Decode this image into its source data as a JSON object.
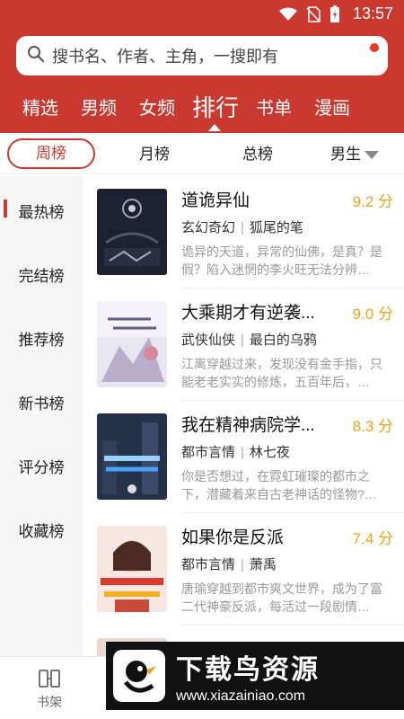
{
  "status": {
    "time": "13:57"
  },
  "search": {
    "placeholder": "搜书名、作者、主角，一搜即有"
  },
  "nav": {
    "items": [
      "精选",
      "男频",
      "女频",
      "排行",
      "书单",
      "漫画"
    ],
    "active": "排行"
  },
  "subtabs": {
    "items": [
      "周榜",
      "月榜",
      "总榜"
    ],
    "gender": "男生"
  },
  "sidebar": {
    "items": [
      "最热榜",
      "完结榜",
      "推荐榜",
      "新书榜",
      "评分榜",
      "收藏榜"
    ]
  },
  "books": [
    {
      "title": "道诡异仙",
      "score": "9.2 分",
      "genre": "玄幻奇幻",
      "author": "狐尾的笔",
      "desc": "诡异的天道，异常的仙佛，是真？是假？陷入迷惘的李火旺无法分辨…"
    },
    {
      "title": "大乘期才有逆袭...",
      "score": "9.0 分",
      "genre": "武侠仙侠",
      "author": "最白的乌鸦",
      "desc": "江离穿越过来，发现没有金手指，只能老老实实的修炼，五百年后，…"
    },
    {
      "title": "我在精神病院学...",
      "score": "8.3 分",
      "genre": "都市言情",
      "author": "林七夜",
      "desc": "你是否想过，在霓虹璀璨的都市之下，潜藏着来自古老神话的怪物?…"
    },
    {
      "title": "如果你是反派",
      "score": "7.4 分",
      "genre": "都市言情",
      "author": "萧禹",
      "desc": "唐瑜穿越到都市爽文世界，成为了富二代神豪反派，每活过一段剧情…"
    }
  ],
  "tabbar": {
    "shelf": "书架"
  },
  "watermark": {
    "cn": "下载鸟资源",
    "url": "www.xiazainiao.com"
  },
  "colors": {
    "brand": "#c9392f",
    "score": "#f0a21e"
  }
}
